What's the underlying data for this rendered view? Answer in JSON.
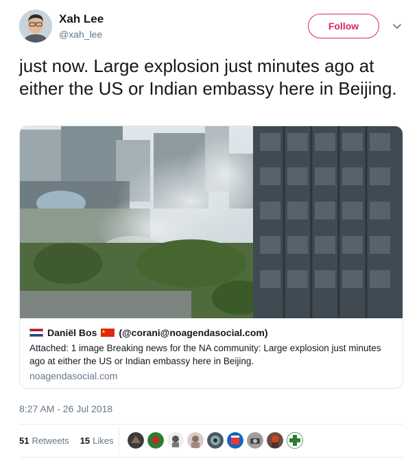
{
  "author": {
    "name": "Xah Lee",
    "handle": "@xah_lee"
  },
  "follow_label": "Follow",
  "tweet_text": "just now. Large explosion just minutes ago at either the US or Indian embassy here in Beijing.",
  "card": {
    "author_name": "Daniël Bos",
    "author_handle": "(@corani@noagendasocial.com)",
    "description": "Attached: 1 image Breaking news for the NA community: Large explosion just minutes ago at either the US or Indian embassy here in Beijing.",
    "domain": "noagendasocial.com"
  },
  "timestamp": "8:27 AM - 26 Jul 2018",
  "stats": {
    "retweets_count": "51",
    "retweets_label": "Retweets",
    "likes_count": "15",
    "likes_label": "Likes"
  },
  "colors": {
    "follow": "#e0245e",
    "secondary_text": "#657786",
    "border": "#e1e8ed"
  },
  "icons": {
    "menu": "chevron-down-icon"
  }
}
